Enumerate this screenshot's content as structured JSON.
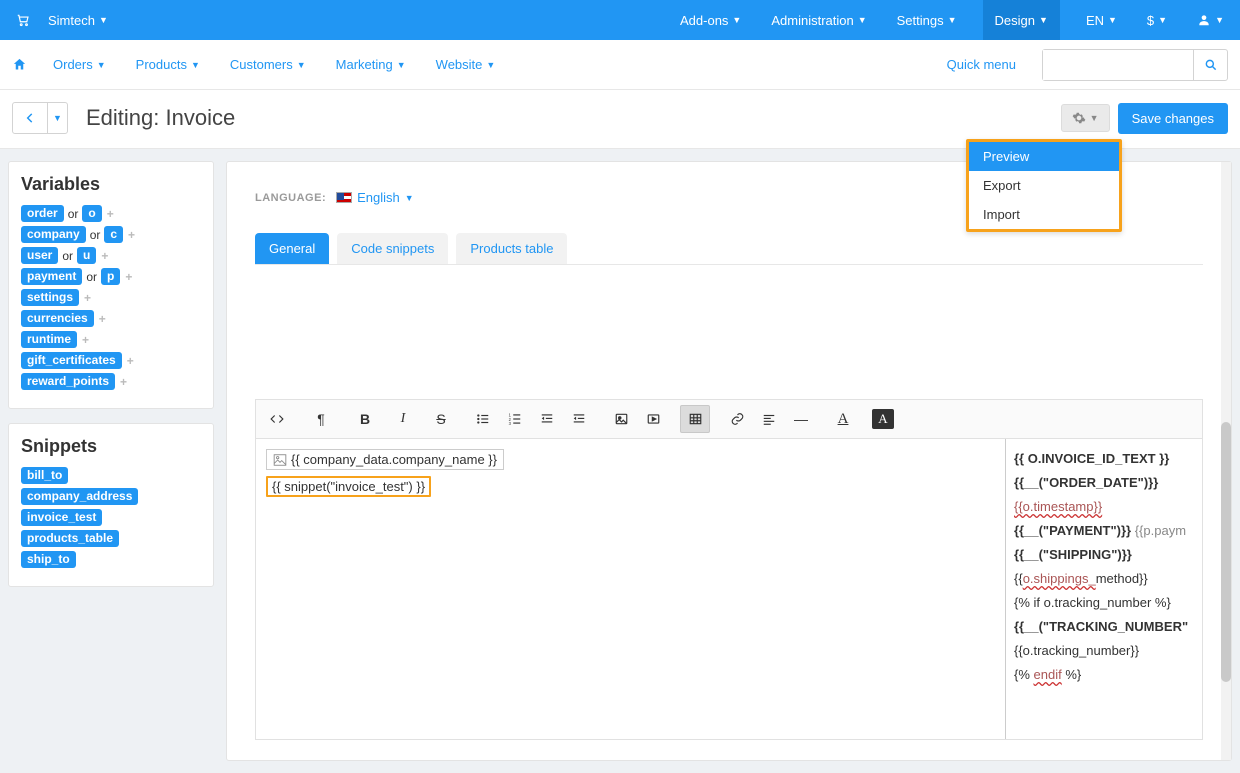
{
  "topbar": {
    "brand": "Simtech",
    "addons": "Add-ons",
    "administration": "Administration",
    "settings": "Settings",
    "design": "Design",
    "lang": "EN",
    "currency": "$"
  },
  "mainnav": {
    "orders": "Orders",
    "products": "Products",
    "customers": "Customers",
    "marketing": "Marketing",
    "website": "Website",
    "quickmenu": "Quick menu"
  },
  "page": {
    "title": "Editing: Invoice",
    "save": "Save changes"
  },
  "gear_menu": {
    "preview": "Preview",
    "export": "Export",
    "import": "Import"
  },
  "variables": {
    "heading": "Variables",
    "or": "or",
    "rows": [
      {
        "long": "order",
        "short": "o"
      },
      {
        "long": "company",
        "short": "c"
      },
      {
        "long": "user",
        "short": "u"
      },
      {
        "long": "payment",
        "short": "p"
      },
      {
        "long": "settings"
      },
      {
        "long": "currencies"
      },
      {
        "long": "runtime"
      },
      {
        "long": "gift_certificates"
      },
      {
        "long": "reward_points"
      }
    ]
  },
  "snippets": {
    "heading": "Snippets",
    "items": [
      "bill_to",
      "company_address",
      "invoice_test",
      "products_table",
      "ship_to"
    ]
  },
  "lang_row": {
    "label": "LANGUAGE:",
    "value": "English"
  },
  "tabs": {
    "general": "General",
    "code": "Code snippets",
    "products": "Products table"
  },
  "editor": {
    "left_img_text": "{{ company_data.company_name }}",
    "left_snippet": "{{ snippet(\"invoice_test\") }}",
    "r1": "{{ O.INVOICE_ID_TEXT }}",
    "r2": "{{__(\"ORDER_DATE\")}}",
    "r3": "{{o.timestamp}}",
    "r4a": "{{__(\"PAYMENT\")}}",
    "r4b": "{{p.paym",
    "r5": "{{__(\"SHIPPING\")}}",
    "r6a": "{{",
    "r6b": "o.shippings_",
    "r6c": "method}}",
    "r7": "{% if o.tracking_number %}",
    "r8": "{{__(\"TRACKING_NUMBER\"",
    "r9": "{{o.tracking_number}}",
    "r10a": "{% ",
    "r10b": "endif",
    "r10c": " %}"
  }
}
